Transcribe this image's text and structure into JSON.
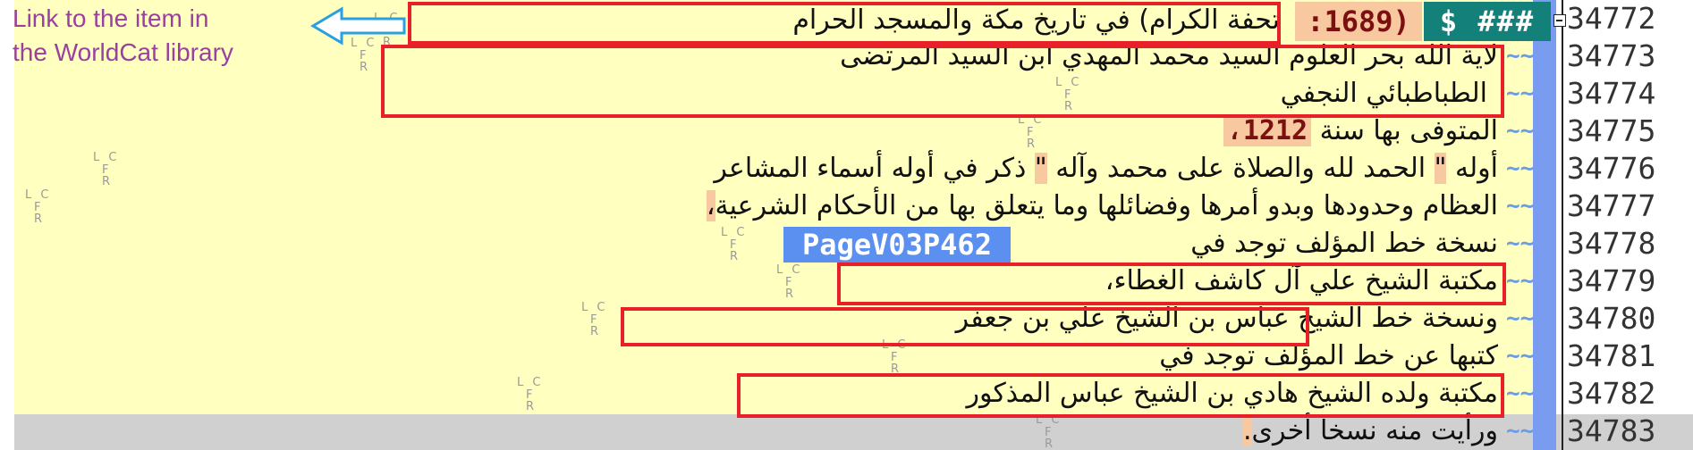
{
  "annotation": {
    "text_line1": "Link to the item in",
    "text_line2": "the WorldCat library"
  },
  "marker": {
    "lc": "L C",
    "fr": "F R"
  },
  "line_numbers": [
    "34772",
    "34773",
    "34774",
    "34775",
    "34776",
    "34777",
    "34778",
    "34779",
    "34780",
    "34781",
    "34782",
    "34783"
  ],
  "fold_marker": "~~",
  "header": {
    "tag": "$ ###",
    "year": ":1689)",
    "title": "تحفة الكرام) في تاريخ مكة والمسجد الحرام"
  },
  "lines": {
    "l34773": "لاية الله بحر العلوم السيد محمد المهدي ابن السيد المرتضى",
    "l34774": "الطباطبائي النجفي",
    "l34775_text": "المتوفى بها سنة",
    "l34775_num": "1212،",
    "l34776_a": "أوله",
    "l34776_q1": "\"",
    "l34776_b": "الحمد لله والصلاة على محمد وآله",
    "l34776_q2": "\"",
    "l34776_c": "ذكر في أوله أسماء المشاعر",
    "l34777_text": "العظام وحدودها وبدو أمرها وفضائلها وما يتعلق بها من الأحكام الشرعية",
    "l34777_punct": "،",
    "l34778_text": "نسخة خط المؤلف توجد في",
    "l34778_tag": "PageV03P462",
    "l34779": "مكتبة الشيخ علي آل كاشف الغطاء،",
    "l34780": "ونسخة خط الشيخ عباس بن الشيخ علي بن جعفر",
    "l34781": "كتبها عن خط المؤلف توجد في",
    "l34782": "مكتبة ولده الشيخ هادي بن الشيخ عباس المذكور",
    "l34783_text": "ورأيت منه نسخا أخرى",
    "l34783_punct": "."
  },
  "colors": {
    "accent_red": "#e8202a",
    "fold_blue": "#7a9cf0",
    "page_tag": "#5b8ff0",
    "header_tag": "#13807a",
    "annotation": "#9b3fa0"
  }
}
